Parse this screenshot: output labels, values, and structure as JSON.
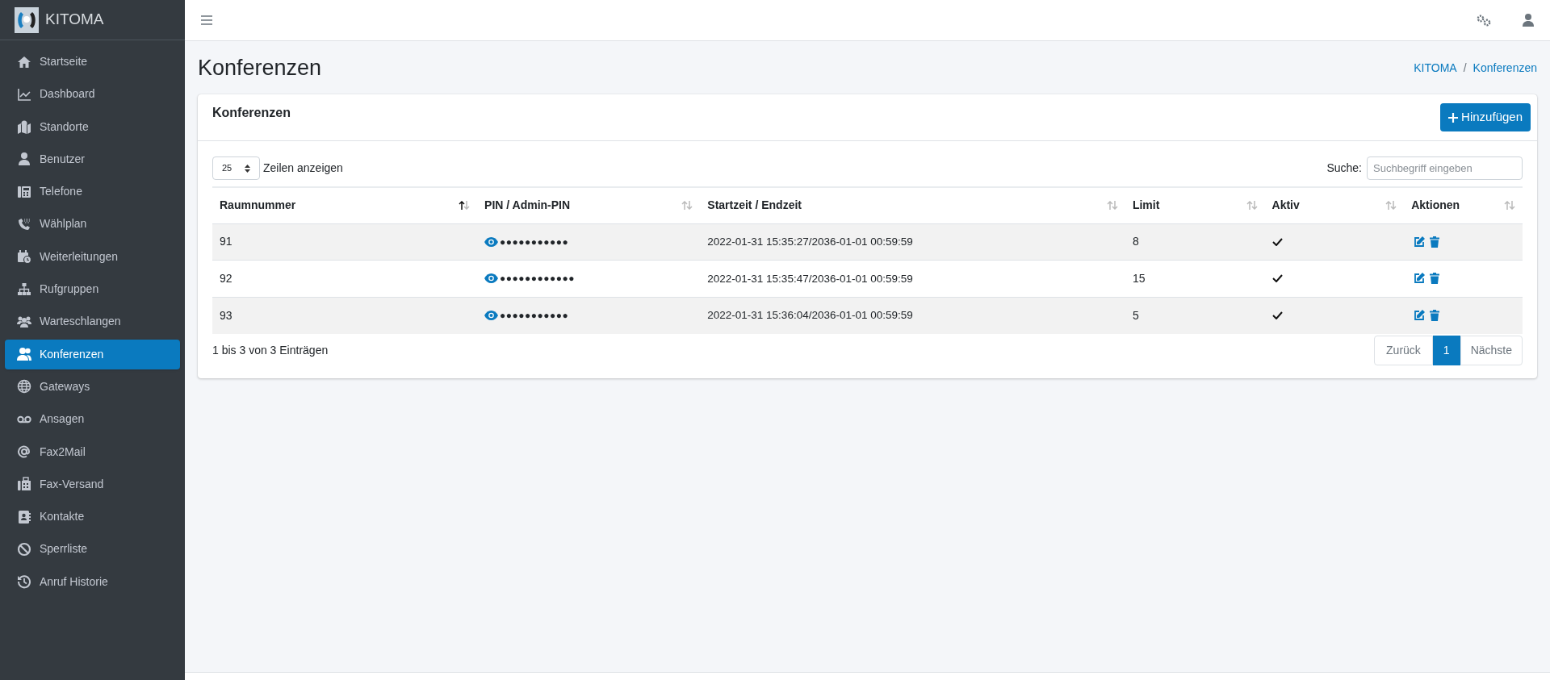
{
  "brand": {
    "name": "KITOMA"
  },
  "sidebar": {
    "items": [
      {
        "label": "Startseite",
        "selected": false
      },
      {
        "label": "Dashboard",
        "selected": false
      },
      {
        "label": "Standorte",
        "selected": false
      },
      {
        "label": "Benutzer",
        "selected": false
      },
      {
        "label": "Telefone",
        "selected": false
      },
      {
        "label": "Wählplan",
        "selected": false
      },
      {
        "label": "Weiterleitungen",
        "selected": false
      },
      {
        "label": "Rufgruppen",
        "selected": false
      },
      {
        "label": "Warteschlangen",
        "selected": false
      },
      {
        "label": "Konferenzen",
        "selected": true
      },
      {
        "label": "Gateways",
        "selected": false
      },
      {
        "label": "Ansagen",
        "selected": false
      },
      {
        "label": "Fax2Mail",
        "selected": false
      },
      {
        "label": "Fax-Versand",
        "selected": false
      },
      {
        "label": "Kontakte",
        "selected": false
      },
      {
        "label": "Sperrliste",
        "selected": false
      },
      {
        "label": "Anruf Historie",
        "selected": false
      }
    ]
  },
  "page": {
    "title": "Konferenzen",
    "breadcrumb": [
      "KITOMA",
      "Konferenzen"
    ],
    "breadcrumb_separator": "/"
  },
  "card": {
    "title": "Konferenzen",
    "add_button": "Hinzufügen",
    "page_size": "25",
    "page_size_label": "Zeilen anzeigen",
    "search_label": "Suche:",
    "search": {
      "placeholder": "Suchbegriff eingeben"
    },
    "table": {
      "columns": [
        {
          "label": "Raumnummer",
          "sorted_ascending": true
        },
        {
          "label": "PIN / Admin-PIN",
          "sorted_ascending": false
        },
        {
          "label": "Startzeit / Endzeit",
          "sorted_ascending": false
        },
        {
          "label": "Limit",
          "sorted_ascending": false
        },
        {
          "label": "Aktiv",
          "sorted_ascending": false
        },
        {
          "label": "Aktionen",
          "sorted_ascending": false
        }
      ],
      "rows": [
        {
          "room": "91",
          "pin": "●●●●●●●●●●●",
          "time": "2022-01-31 15:35:27/2036-01-01 00:59:59",
          "limit": "8",
          "active": true
        },
        {
          "room": "92",
          "pin": "●●●●●●●●●●●●",
          "time": "2022-01-31 15:35:47/2036-01-01 00:59:59",
          "limit": "15",
          "active": true
        },
        {
          "room": "93",
          "pin": "●●●●●●●●●●●",
          "time": "2022-01-31 15:36:04/2036-01-01 00:59:59",
          "limit": "5",
          "active": true
        }
      ]
    },
    "info": "1 bis 3 von 3 Einträgen",
    "pagination": {
      "previous": "Zurück",
      "pages": [
        {
          "label": "1",
          "selected": true
        }
      ],
      "next": "Nächste"
    }
  }
}
